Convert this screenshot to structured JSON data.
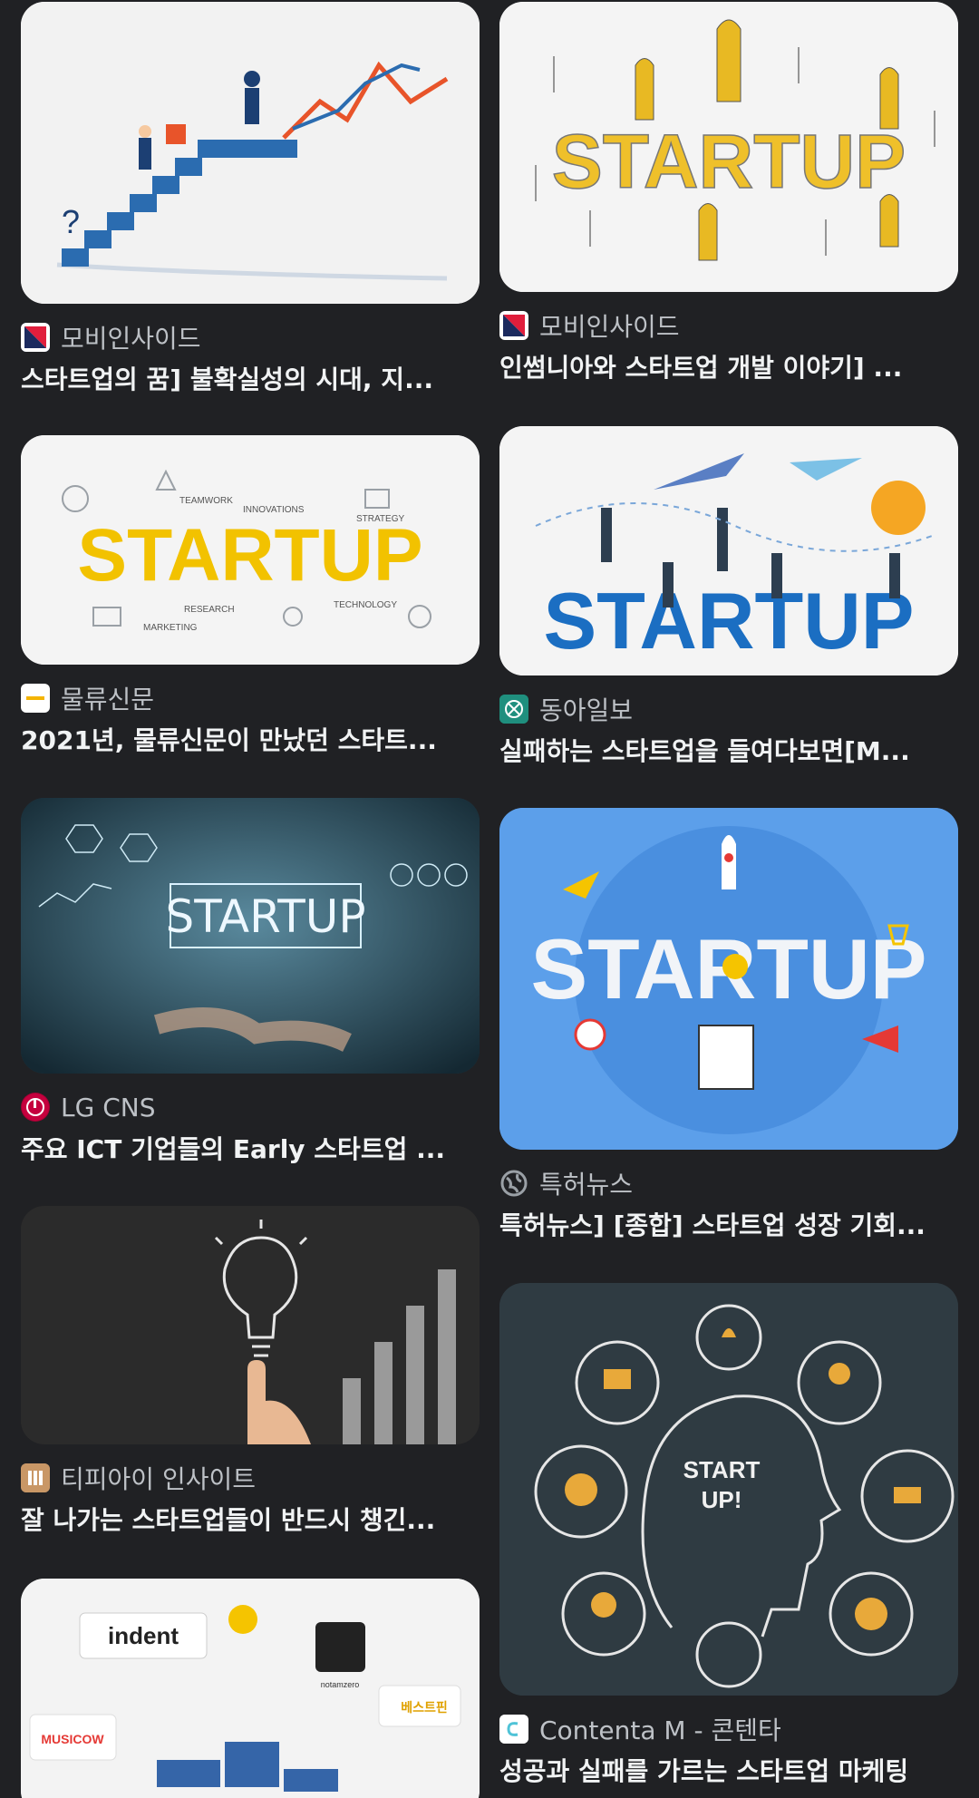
{
  "results": {
    "left": [
      {
        "source": "모비인사이드",
        "title": "스타트업의 꿈] 불확실성의 시대, 지...",
        "favicon": "mobiinside-icon"
      },
      {
        "source": "물류신문",
        "title": "2021년, 물류신문이 만났던 스타트...",
        "favicon": "klnews-icon"
      },
      {
        "source": "LG CNS",
        "title": "주요 ICT 기업들의 Early 스타트업 ...",
        "favicon": "lg-icon"
      },
      {
        "source": "티피아이 인사이트",
        "title": "잘 나가는 스타트업들이 반드시 챙긴...",
        "favicon": "tpi-icon"
      },
      {
        "source": "",
        "title": "",
        "favicon": ""
      }
    ],
    "right": [
      {
        "source": "모비인사이드",
        "title": "인썸니아와 스타트업 개발 이야기] ...",
        "favicon": "mobiinside-icon"
      },
      {
        "source": "동아일보",
        "title": "실패하는 스타트업을 들여다보면[M...",
        "favicon": "donga-icon"
      },
      {
        "source": "특허뉴스",
        "title": "특허뉴스] [종합] 스타트업 성장 기회...",
        "favicon": "globe-icon"
      },
      {
        "source": "Contenta M - 콘텐타",
        "title": "성공과 실패를 가르는 스타트업 마케팅",
        "favicon": "contenta-icon"
      }
    ]
  },
  "image_text": {
    "startup_word": "STARTUP",
    "startup_mixed": "STARTUP",
    "startup_up": "START",
    "startup_up2": "UP!",
    "teamwork": "TEAMWORK",
    "innovations": "INNOVATIONS",
    "strategy": "STRATEGY",
    "research": "RESEARCH",
    "technology": "TECHNOLOGY",
    "marketing": "MARKETING",
    "indent": "indent",
    "musicow": "MUSICOW",
    "bestpin": "베스트핀",
    "notamzero": "notamzero"
  },
  "colors": {
    "background": "#202124",
    "source_text": "#bdc1c6",
    "title_text": "#f1f3f4"
  }
}
